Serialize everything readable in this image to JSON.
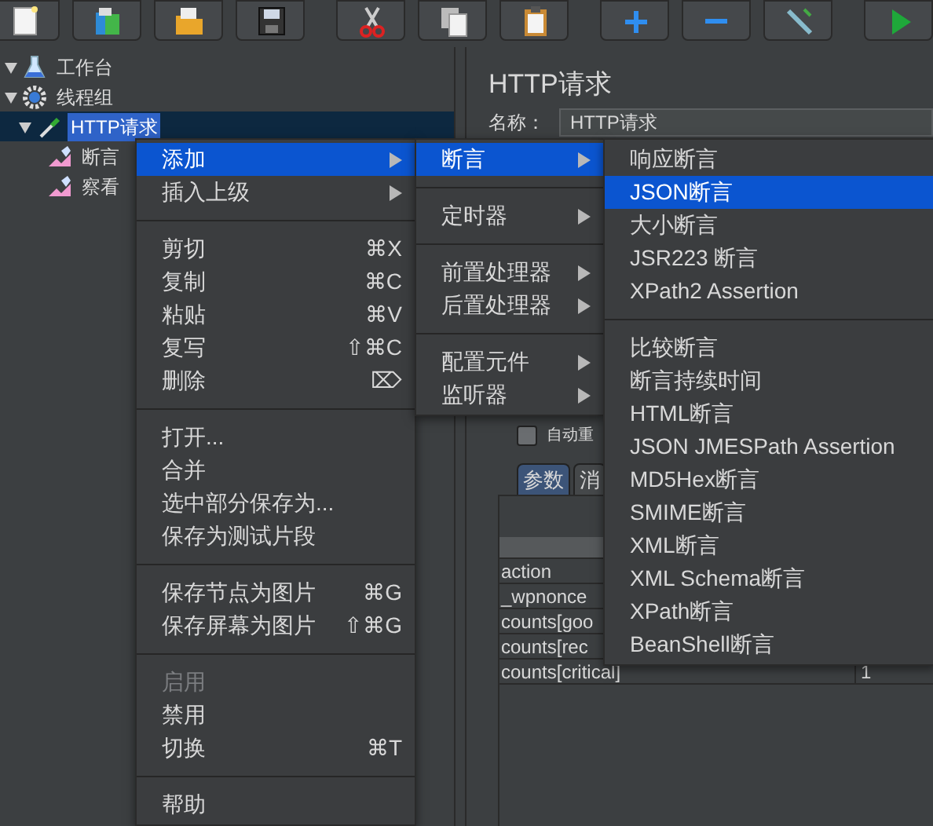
{
  "tree": [
    {
      "label": "工作台",
      "kind": "workbench",
      "expanded": true,
      "selected": false
    },
    {
      "label": "线程组",
      "kind": "thread-group",
      "expanded": true,
      "selected": false,
      "children": [
        {
          "label": "HTTP请求",
          "kind": "sampler",
          "expanded": true,
          "selected": true,
          "children": [
            {
              "label": "断言",
              "kind": "listener",
              "selected": false
            },
            {
              "label": "察看",
              "kind": "listener",
              "selected": false
            }
          ]
        }
      ]
    }
  ],
  "panel": {
    "title": "HTTP请求",
    "name_label": "名称：",
    "name_value": "HTTP请求",
    "checkbox": {
      "label": "自动重",
      "checked": false
    },
    "tabs": [
      {
        "label": "参数",
        "selected": true
      },
      {
        "label": "消",
        "selected": false
      }
    ],
    "table": {
      "rows": [
        {
          "name": "action",
          "value": ""
        },
        {
          "name": "_wpnonce",
          "value": ""
        },
        {
          "name": "counts[goo",
          "value": ""
        },
        {
          "name": "counts[rec",
          "value": ""
        },
        {
          "name": "counts[critical]",
          "value": "1"
        }
      ]
    }
  },
  "context_menu": {
    "items": [
      {
        "kind": "item",
        "label": "添加",
        "selected": true,
        "disabled": false,
        "submenu": true
      },
      {
        "kind": "item",
        "label": "插入上级",
        "selected": false,
        "disabled": false,
        "submenu": true
      },
      {
        "kind": "separator"
      },
      {
        "kind": "item",
        "label": "剪切",
        "shortcut": "⌘X",
        "selected": false,
        "disabled": false
      },
      {
        "kind": "item",
        "label": "复制",
        "shortcut": "⌘C",
        "selected": false,
        "disabled": false
      },
      {
        "kind": "item",
        "label": "粘贴",
        "shortcut": "⌘V",
        "selected": false,
        "disabled": false
      },
      {
        "kind": "item",
        "label": "复写",
        "shortcut": "⇧⌘C",
        "selected": false,
        "disabled": false
      },
      {
        "kind": "item",
        "label": "删除",
        "shortcut": "⌦",
        "selected": false,
        "disabled": false
      },
      {
        "kind": "separator"
      },
      {
        "kind": "item",
        "label": "打开...",
        "selected": false,
        "disabled": false
      },
      {
        "kind": "item",
        "label": "合并",
        "selected": false,
        "disabled": false
      },
      {
        "kind": "item",
        "label": "选中部分保存为...",
        "selected": false,
        "disabled": false
      },
      {
        "kind": "item",
        "label": "保存为测试片段",
        "selected": false,
        "disabled": false
      },
      {
        "kind": "separator"
      },
      {
        "kind": "item",
        "label": "保存节点为图片",
        "shortcut": "⌘G",
        "selected": false,
        "disabled": false
      },
      {
        "kind": "item",
        "label": "保存屏幕为图片",
        "shortcut": "⇧⌘G",
        "selected": false,
        "disabled": false
      },
      {
        "kind": "separator"
      },
      {
        "kind": "item",
        "label": "启用",
        "selected": false,
        "disabled": true
      },
      {
        "kind": "item",
        "label": "禁用",
        "selected": false,
        "disabled": false
      },
      {
        "kind": "item",
        "label": "切换",
        "shortcut": "⌘T",
        "selected": false,
        "disabled": false
      },
      {
        "kind": "separator"
      },
      {
        "kind": "item",
        "label": "帮助",
        "selected": false,
        "disabled": false
      }
    ]
  },
  "add_submenu": {
    "items": [
      {
        "kind": "item",
        "label": "断言",
        "selected": true,
        "submenu": true
      },
      {
        "kind": "separator"
      },
      {
        "kind": "item",
        "label": "定时器",
        "selected": false,
        "submenu": true
      },
      {
        "kind": "separator"
      },
      {
        "kind": "item",
        "label": "前置处理器",
        "selected": false,
        "submenu": true
      },
      {
        "kind": "item",
        "label": "后置处理器",
        "selected": false,
        "submenu": true
      },
      {
        "kind": "separator"
      },
      {
        "kind": "item",
        "label": "配置元件",
        "selected": false,
        "submenu": true
      },
      {
        "kind": "item",
        "label": "监听器",
        "selected": false,
        "submenu": true
      }
    ]
  },
  "assertion_submenu": {
    "items": [
      {
        "kind": "item",
        "label": "响应断言",
        "selected": false
      },
      {
        "kind": "item",
        "label": "JSON断言",
        "selected": true
      },
      {
        "kind": "item",
        "label": "大小断言",
        "selected": false
      },
      {
        "kind": "item",
        "label": "JSR223 断言",
        "selected": false
      },
      {
        "kind": "item",
        "label": "XPath2 Assertion",
        "selected": false
      },
      {
        "kind": "separator"
      },
      {
        "kind": "item",
        "label": "比较断言",
        "selected": false
      },
      {
        "kind": "item",
        "label": "断言持续时间",
        "selected": false
      },
      {
        "kind": "item",
        "label": "HTML断言",
        "selected": false
      },
      {
        "kind": "item",
        "label": "JSON JMESPath Assertion",
        "selected": false
      },
      {
        "kind": "item",
        "label": "MD5Hex断言",
        "selected": false
      },
      {
        "kind": "item",
        "label": "SMIME断言",
        "selected": false
      },
      {
        "kind": "item",
        "label": "XML断言",
        "selected": false
      },
      {
        "kind": "item",
        "label": "XML Schema断言",
        "selected": false
      },
      {
        "kind": "item",
        "label": "XPath断言",
        "selected": false
      },
      {
        "kind": "item",
        "label": "BeanShell断言",
        "selected": false
      }
    ]
  }
}
